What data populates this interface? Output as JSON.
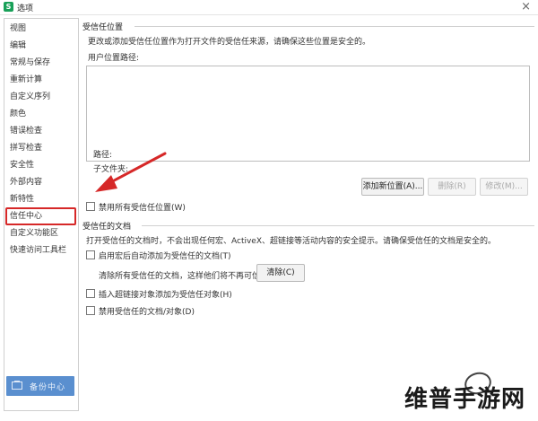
{
  "window": {
    "title": "选项",
    "app_icon": "S",
    "close": "×"
  },
  "sidebar": {
    "items": [
      {
        "label": "视图",
        "selected": false
      },
      {
        "label": "编辑",
        "selected": false
      },
      {
        "label": "常规与保存",
        "selected": false
      },
      {
        "label": "重新计算",
        "selected": false
      },
      {
        "label": "自定义序列",
        "selected": false
      },
      {
        "label": "颜色",
        "selected": false
      },
      {
        "label": "错误检查",
        "selected": false
      },
      {
        "label": "拼写检查",
        "selected": false
      },
      {
        "label": "安全性",
        "selected": false
      },
      {
        "label": "外部内容",
        "selected": false
      },
      {
        "label": "新特性",
        "selected": false
      },
      {
        "label": "信任中心",
        "selected": true
      },
      {
        "label": "自定义功能区",
        "selected": false
      },
      {
        "label": "快速访问工具栏",
        "selected": false
      }
    ],
    "backup_label": "备份中心"
  },
  "trusted_locations": {
    "section_title": "受信任位置",
    "description": "更改或添加受信任位置作为打开文件的受信任来源，请确保这些位置是安全的。",
    "user_paths_label": "用户位置路径:",
    "path_label": "路径:",
    "subfolder_label": "子文件夹:",
    "add_button": "添加新位置(A)...",
    "delete_button": "删除(R)",
    "modify_button": "修改(M)...",
    "disable_all_label": "禁用所有受信任位置(W)"
  },
  "trusted_documents": {
    "section_title": "受信任的文档",
    "description": "打开受信任的文档时，不会出现任何宏、ActiveX、超链接等活动内容的安全提示。请确保受信任的文档是安全的。",
    "auto_add_macro_label": "启用宏后自动添加为受信任的文档(T)",
    "clear_desc": "清除所有受信任的文档，这样他们将不再可信",
    "clear_button": "清除(C)",
    "insert_hyperlink_label": "插入超链接对象添加为受信任对象(H)",
    "disable_docs_label": "禁用受信任的文档/对象(D)"
  },
  "watermark": {
    "text": "维普手游网"
  },
  "colors": {
    "selected_border": "#d62828",
    "arrow": "#d62828",
    "backup_bg": "#5a8fcf"
  }
}
